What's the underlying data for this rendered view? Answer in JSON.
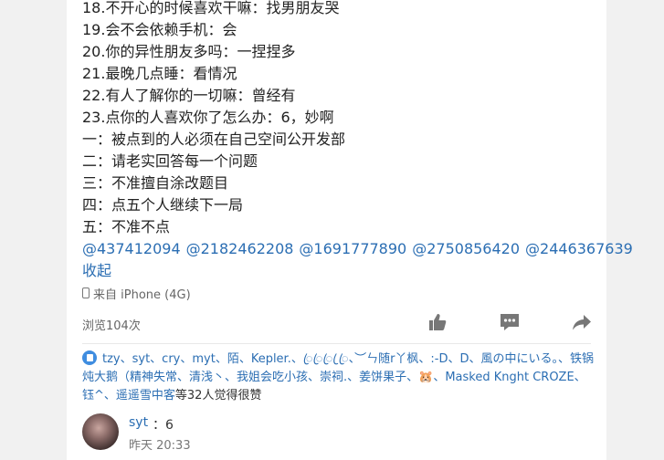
{
  "post": {
    "lines": [
      "18.不开心的时候喜欢干嘛：找男朋友哭",
      "19.会不会依赖手机：会",
      "20.你的异性朋友多吗：一捏捏多",
      "21.最晚几点睡：看情况",
      "22.有人了解你的一切嘛：曾经有",
      "23.点你的人喜欢你了怎么办：6，妙啊",
      "一：被点到的人必须在自己空间公开发部",
      "二：请老实回答每一个问题",
      "三：不准擅自涂改题目",
      "四：点五个人继续下一局",
      "五：不准不点"
    ],
    "mentions": [
      "@437412094",
      "@2182462208",
      "@1691777890",
      "@2750856420",
      "@2446367639"
    ],
    "collapse_label": "收起",
    "device": "来自 iPhone (4G)"
  },
  "stats": {
    "views": "浏览104次"
  },
  "actions": {
    "icons": [
      "like-icon",
      "comment-icon",
      "share-icon"
    ]
  },
  "likes": {
    "names": "tzy、syt、cry、myt、陌、Kepler.、ꦿꦿꦿ ꦿꦿ、︶ㄣ随r丫枫、:-D、D、風の中にいる。、铁锅炖大鹅（精神失常、清浅丶、我姐会吃小孩、崇祠.、姜饼果子、🐹、Masked Knght CROZE、钰^、遥遥雪中客",
    "tail": "等32人觉得很赞"
  },
  "comment": {
    "name": "syt",
    "text": "：6",
    "time": "昨天 20:33"
  },
  "colors": {
    "link": "#2b6eb3",
    "text": "#222222",
    "muted": "#666666",
    "background": "#f1f1f1"
  }
}
